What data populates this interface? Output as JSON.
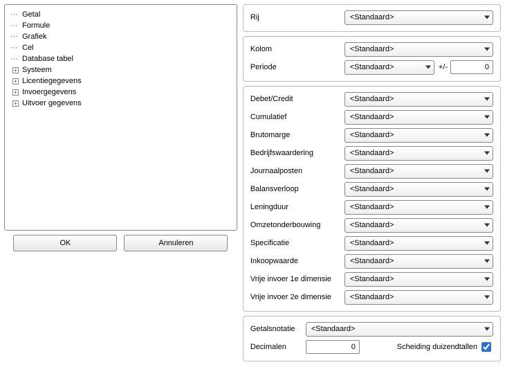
{
  "tree": {
    "leaf_items": [
      {
        "label": "Getal"
      },
      {
        "label": "Formule"
      },
      {
        "label": "Grafiek"
      },
      {
        "label": "Cel"
      },
      {
        "label": "Database tabel"
      }
    ],
    "expandable_items": [
      {
        "label": "Systeem"
      },
      {
        "label": "Licentiegegevens"
      },
      {
        "label": "Invoergegevens"
      },
      {
        "label": "Uitvoer gegevens"
      }
    ]
  },
  "buttons": {
    "ok": "OK",
    "cancel": "Annuleren"
  },
  "combos": {
    "standard": "<Standaard>"
  },
  "group1": {
    "rij": {
      "label": "Rij"
    }
  },
  "group2": {
    "kolom": {
      "label": "Kolom"
    },
    "periode": {
      "label": "Periode",
      "pm_label": "+/-",
      "value": "0"
    }
  },
  "group3": {
    "debetcredit": {
      "label": "Debet/Credit"
    },
    "cumulatief": {
      "label": "Cumulatief"
    },
    "brutomarge": {
      "label": "Brutomarge"
    },
    "bedrijfswaardering": {
      "label": "Bedrijfswaardering"
    },
    "journaalposten": {
      "label": "Journaalposten"
    },
    "balansverloop": {
      "label": "Balansverloop"
    },
    "leningduur": {
      "label": "Leningduur"
    },
    "omzetonderbouwing": {
      "label": "Omzetonderbouwing"
    },
    "specificatie": {
      "label": "Specificatie"
    },
    "inkoopwaarde": {
      "label": "Inkoopwaarde"
    },
    "vrije1": {
      "label": "Vrije invoer 1e dimensie"
    },
    "vrije2": {
      "label": "Vrije invoer 2e dimensie"
    }
  },
  "group4": {
    "getalsnotatie": {
      "label": "Getalsnotatie"
    },
    "decimalen": {
      "label": "Decimalen",
      "value": "0"
    },
    "scheiding": {
      "label": "Scheiding duizendtallen",
      "checked": true
    }
  }
}
